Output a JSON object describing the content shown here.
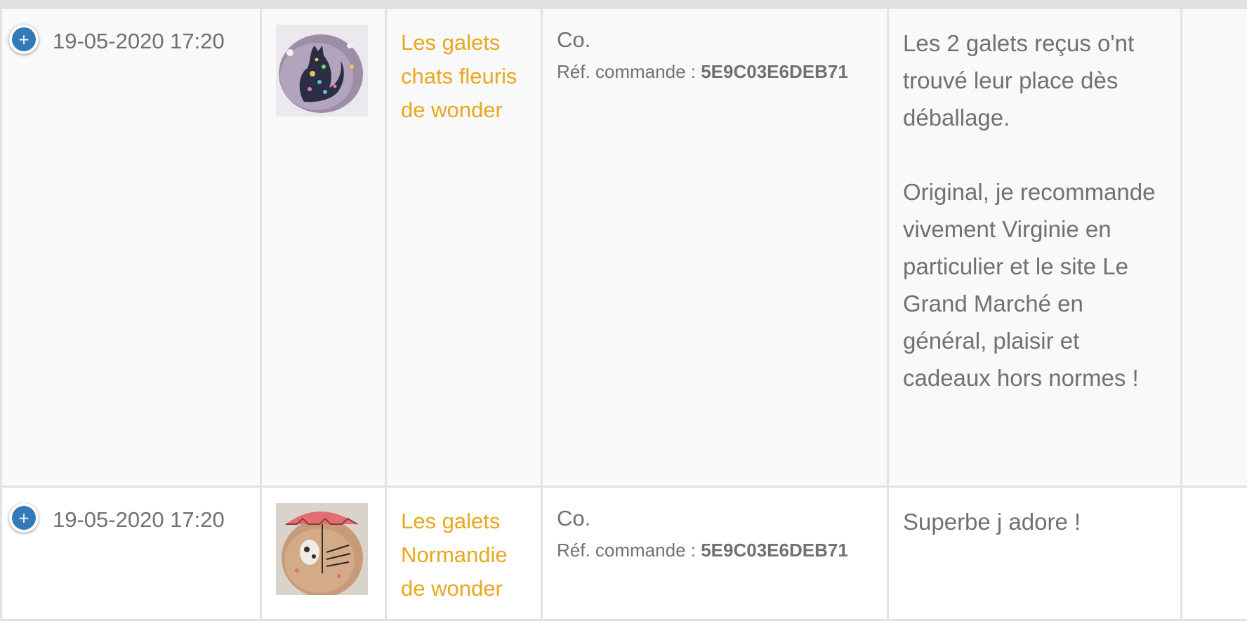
{
  "reviews": [
    {
      "date": "19-05-2020 17:20",
      "expand_label": "+",
      "image_icon": "painted-pebble-cat-thumbnail",
      "product": "Les galets chats fleuris de wonder",
      "customer": "Co.",
      "order_ref_label": "Réf. commande :",
      "order_ref": "5E9C03E6DEB71",
      "comment": "Les 2 galets reçus o'nt trouvé leur place dès déballage.\n\nOriginal, je recommande vivement  Virginie en particulier et le site Le Grand Marché en général, plaisir et cadeaux hors normes !"
    },
    {
      "date": "19-05-2020 17:20",
      "expand_label": "+",
      "image_icon": "painted-pebble-normandie-thumbnail",
      "product": "Les galets Normandie de wonder",
      "customer": "Co.",
      "order_ref_label": "Réf. commande :",
      "order_ref": "5E9C03E6DEB71",
      "comment": "Superbe j adore !"
    }
  ],
  "colors": {
    "link": "#e8a71e",
    "button": "#337ab7",
    "border": "#e2e2e2",
    "text": "#707075"
  }
}
